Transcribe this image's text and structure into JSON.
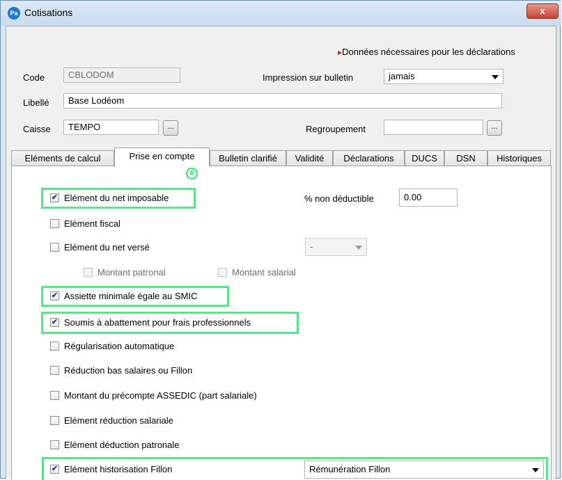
{
  "window": {
    "title": "Cotisations",
    "app_icon": "Pa",
    "close": "x"
  },
  "notice": "Données nécessaires pour les déclarations",
  "fields": {
    "code_label": "Code",
    "code_value": "CBLODOM",
    "impression_label": "Impression sur bulletin",
    "impression_value": "jamais",
    "libelle_label": "Libellé",
    "libelle_value": "Base Lodéom",
    "caisse_label": "Caisse",
    "caisse_value": "TEMPO",
    "regroupement_label": "Regroupement",
    "regroupement_value": "",
    "browse": "..."
  },
  "tabs": [
    {
      "label": "Eléments de calcul"
    },
    {
      "label": "Prise en compte",
      "active": true
    },
    {
      "label": "Bulletin clarifié"
    },
    {
      "label": "Validité"
    },
    {
      "label": "Déclarations"
    },
    {
      "label": "DUCS"
    },
    {
      "label": "DSN"
    },
    {
      "label": "Historiques"
    }
  ],
  "step_marker": "6",
  "options": {
    "net_imposable": {
      "label": "Elément du net imposable",
      "checked": true
    },
    "non_deductible_label": "% non déductible",
    "non_deductible_value": "0.00",
    "fiscal": {
      "label": "Elément fiscal",
      "checked": false
    },
    "net_verse": {
      "label": "Elément du net versé",
      "checked": false
    },
    "net_verse_combo": "-",
    "montant_patronal": {
      "label": "Montant patronal",
      "checked": false
    },
    "montant_salarial": {
      "label": "Montant salarial",
      "checked": false
    },
    "assiette_smic": {
      "label": "Assiette minimale égale au SMIC",
      "checked": true
    },
    "abattement": {
      "label": "Soumis à abattement pour frais professionnels",
      "checked": true
    },
    "regularisation": {
      "label": "Régularisation automatique",
      "checked": false
    },
    "reduction_fillon": {
      "label": "Réduction bas salaires ou Fillon",
      "checked": false
    },
    "precompte_assedic": {
      "label": "Montant du précompte ASSEDIC (part salariale)",
      "checked": false
    },
    "reduction_salariale": {
      "label": "Elément réduction salariale",
      "checked": false
    },
    "deduction_patronale": {
      "label": "Elément déduction patronale",
      "checked": false
    },
    "historisation_fillon": {
      "label": "Elément historisation Fillon",
      "checked": true
    },
    "historisation_combo": "Rémunération Fillon"
  },
  "colors": {
    "highlight": "#56e58a",
    "required_marker": "#d02020"
  }
}
